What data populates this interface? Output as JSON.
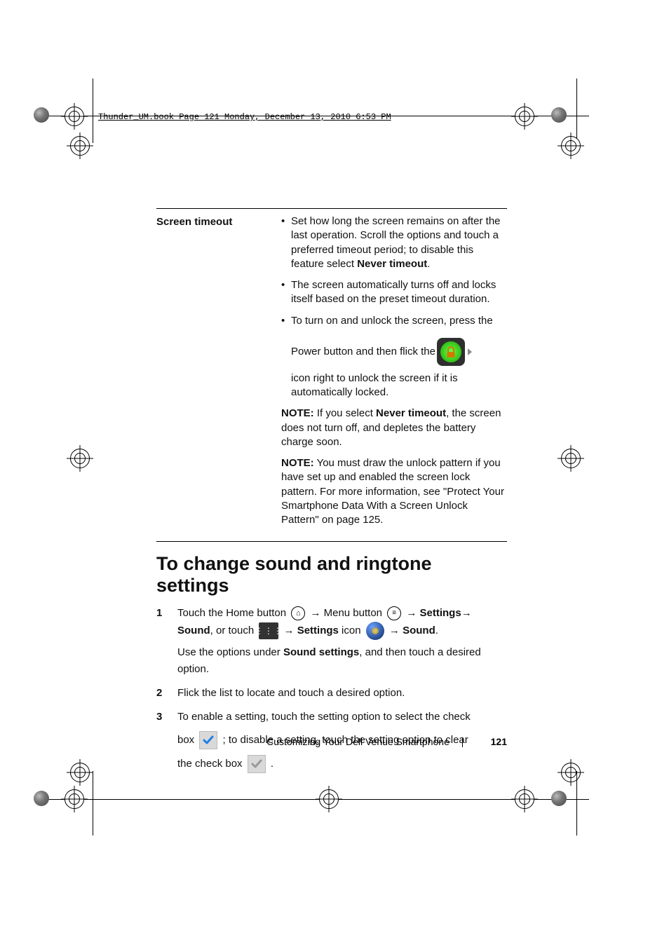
{
  "header": "Thunder_UM.book  Page 121  Monday, December 13, 2010  6:53 PM",
  "table": {
    "label": "Screen timeout",
    "bullets": [
      {
        "preNever": "Set how long the screen remains on after the last operation. Scroll the options and touch a preferred timeout period; to disable this feature select ",
        "never": "Never timeout",
        "post": "."
      },
      {
        "plain": "The screen automatically turns off and locks itself based on the preset timeout duration."
      },
      {
        "line1": "To turn on and unlock the screen, press the",
        "line2pre": "Power button and then flick the ",
        "line3": "icon right to unlock the screen if it is automatically locked."
      }
    ],
    "note1": {
      "title": "NOTE:",
      "pre": " If you select ",
      "never": "Never timeout",
      "post": ", the screen does not turn off, and depletes the battery charge soon."
    },
    "note2": {
      "title": "NOTE:",
      "body": " You must draw the unlock pattern if you have set up and enabled the screen lock pattern. For more information, see \"Protect Your Smartphone Data With a Screen Unlock Pattern\" on page 125."
    }
  },
  "section_title": "To change sound and ringtone settings",
  "steps": {
    "s1": {
      "touch_home": "Touch the Home button ",
      "arrow": "→",
      "menu_label": " Menu button ",
      "settings_bold": "Settings",
      "sound_bold": "Sound",
      "or_touch": ", or touch ",
      "settings_label": "Settings",
      "icon_word": " icon ",
      "sound2_bold": "Sound",
      "period": ".",
      "line2a": "Use the options under ",
      "sound_settings_bold": "Sound settings",
      "line2b": ", and then touch a desired option."
    },
    "s2": "Flick the list to locate and touch a desired option.",
    "s3": {
      "a": "To enable a setting, touch the setting option to select the check",
      "b_pre": "box ",
      "b_post": " ; to disable a setting, touch the setting option to clear",
      "c_pre": "the check box ",
      "c_post": " ."
    }
  },
  "footer": {
    "title": "Customizing Your Dell Venue Smartphone",
    "page": "121"
  }
}
